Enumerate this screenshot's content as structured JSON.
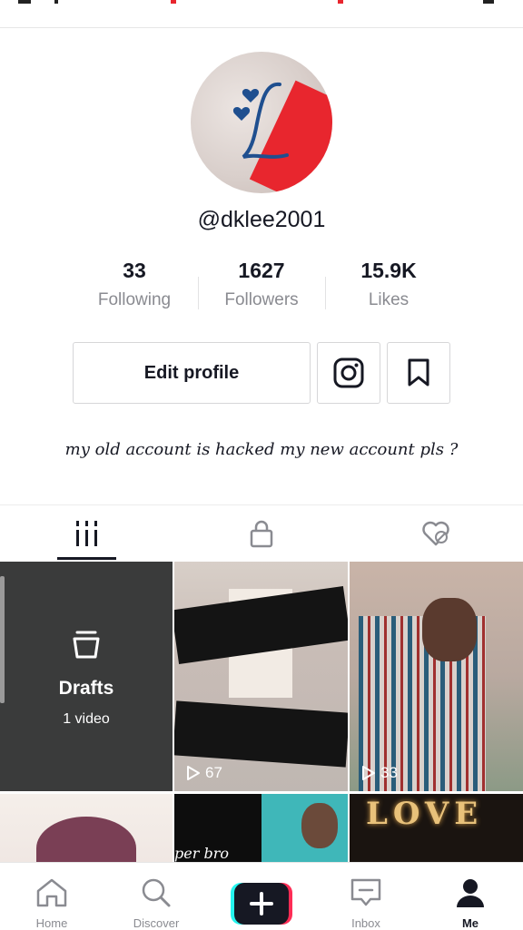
{
  "profile": {
    "username": "@dklee2001",
    "bio": "my old account is hacked my new account pls ?"
  },
  "stats": [
    {
      "value": "33",
      "label": "Following"
    },
    {
      "value": "1627",
      "label": "Followers"
    },
    {
      "value": "15.9K",
      "label": "Likes"
    }
  ],
  "actions": {
    "edit_profile": "Edit profile"
  },
  "grid": {
    "drafts_title": "Drafts",
    "drafts_count": "1 video",
    "video1_views": "67",
    "video2_views": "33",
    "video4_caption": "per bro",
    "video5_caption": "LOVE"
  },
  "nav": {
    "home": "Home",
    "discover": "Discover",
    "inbox": "Inbox",
    "me": "Me"
  },
  "colors": {
    "accent_red": "#fe2c55",
    "accent_cyan": "#25f4ee",
    "text_primary": "#161823",
    "text_secondary": "#8a8b91"
  }
}
